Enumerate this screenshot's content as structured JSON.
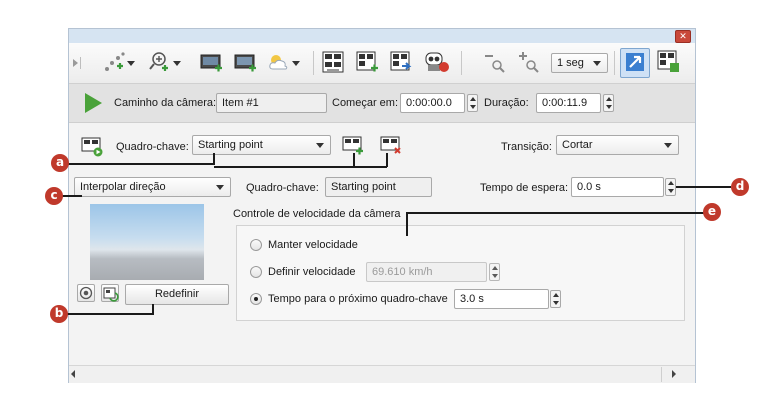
{
  "window": {
    "close_glyph": "✕"
  },
  "toolbar": {
    "zoom_level": "1 seg",
    "icons": [
      "expand-arrow-icon",
      "add-node-path-icon",
      "zoom-in-dropdown-icon",
      "add-camera-screen-icon",
      "camera-screen-icon",
      "weather-cloud-icon",
      "keyframe-grid-icon",
      "keyframe-add-icon",
      "keyframe-next-icon",
      "record-camera-icon",
      "zoom-out-icon",
      "zoom-in-small-icon",
      "link-edit-icon",
      "table-grid-icon"
    ]
  },
  "path": {
    "camera_path_label": "Caminho da câmera:",
    "camera_path_value": "Item #1",
    "start_label": "Começar em:",
    "start_value": "0:00:00.0",
    "duration_label": "Duração:",
    "duration_value": "0:00:11.9"
  },
  "keyframe": {
    "label": "Quadro-chave:",
    "selected": "Starting point",
    "transition_label": "Transição:",
    "transition_value": "Cortar",
    "direction_value": "Interpolar direção",
    "name_label": "Quadro-chave:",
    "name_value": "Starting point",
    "wait_label": "Tempo de espera:",
    "wait_value": "0.0 s",
    "reset_button": "Redefinir"
  },
  "speed": {
    "group_title": "Controle de velocidade da câmera",
    "keep_label": "Manter velocidade",
    "define_label": "Definir velocidade",
    "define_value": "69.610 km/h",
    "time_label": "Tempo para o próximo quadro-chave",
    "time_value": "3.0 s",
    "selected": "time"
  },
  "callouts": {
    "a": "a",
    "b": "b",
    "c": "c",
    "d": "d",
    "e": "e"
  },
  "colors": {
    "callout": "#c0392b",
    "accent": "#3b7fd0",
    "play": "#4aa23a"
  }
}
